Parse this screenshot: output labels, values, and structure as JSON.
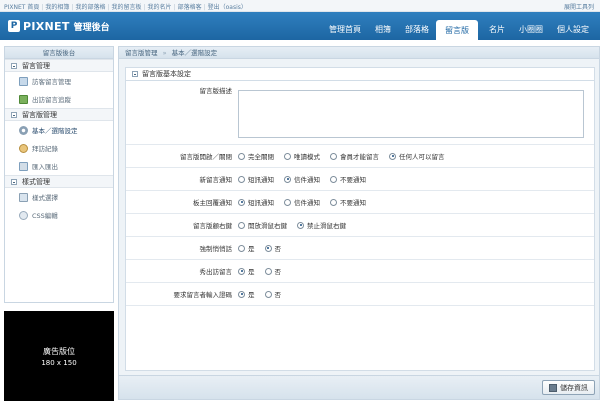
{
  "topbar": {
    "links": [
      "PIXNET 首頁",
      "我的相簿",
      "我的部落格",
      "我的留言板",
      "我的名片",
      "部落格客",
      "登出（oasis）"
    ],
    "toolbox": "展開工具列"
  },
  "header": {
    "logo_mark": "P",
    "logo_text": "PIXNET",
    "logo_sub": "管理後台",
    "nav_main": [
      "管理首頁",
      "相簿",
      "部落格",
      "留言版"
    ],
    "nav_right": [
      "名片",
      "小圈圈",
      "個人設定"
    ],
    "active_nav": "留言版"
  },
  "sidebar": {
    "title": "留言版後台",
    "groups": [
      {
        "label": "留言管理",
        "items": [
          {
            "label": "訪客留言管理",
            "icon": "document-icon"
          },
          {
            "label": "出訪留言追蹤",
            "icon": "outbox-icon"
          }
        ]
      },
      {
        "label": "留言版管理",
        "items": [
          {
            "label": "基本／選階設定",
            "icon": "gear-icon"
          },
          {
            "label": "拜訪紀錄",
            "icon": "users-icon"
          },
          {
            "label": "匯入匯出",
            "icon": "import-export-icon"
          }
        ]
      },
      {
        "label": "樣式管理",
        "items": [
          {
            "label": "樣式選擇",
            "icon": "grid-icon"
          },
          {
            "label": "CSS編輯",
            "icon": "css-icon"
          }
        ]
      }
    ],
    "ad": {
      "title": "廣告版位",
      "size": "180 x 150"
    }
  },
  "breadcrumb": {
    "root": "留言版管理",
    "separator": "»",
    "current": "基本／選階設定"
  },
  "panel": {
    "title": "留言版基本設定",
    "description_label": "留言版描述",
    "description_value": "",
    "rows": [
      {
        "label": "留言版開啟／關閉",
        "options": [
          "完全關閉",
          "唯讀模式",
          "會員才能留言",
          "任何人可以留言"
        ],
        "selected": 3
      },
      {
        "label": "新留言通知",
        "options": [
          "短訊通知",
          "信件通知",
          "不要通知"
        ],
        "selected": 1
      },
      {
        "label": "板主回覆通知",
        "options": [
          "短訊通知",
          "信件通知",
          "不要通知"
        ],
        "selected": 0
      },
      {
        "label": "留言版顧右鍵",
        "options": [
          "開放滑鼠右鍵",
          "禁止滑鼠右鍵"
        ],
        "selected": 1
      },
      {
        "label": "強制悄悄話",
        "options": [
          "是",
          "否"
        ],
        "selected": 1
      },
      {
        "label": "秀出訪留言",
        "options": [
          "是",
          "否"
        ],
        "selected": 0
      },
      {
        "label": "要求留言者輸入證碼",
        "options": [
          "是",
          "否"
        ],
        "selected": 0
      }
    ]
  },
  "footer": {
    "save_label": "儲存資訊"
  }
}
